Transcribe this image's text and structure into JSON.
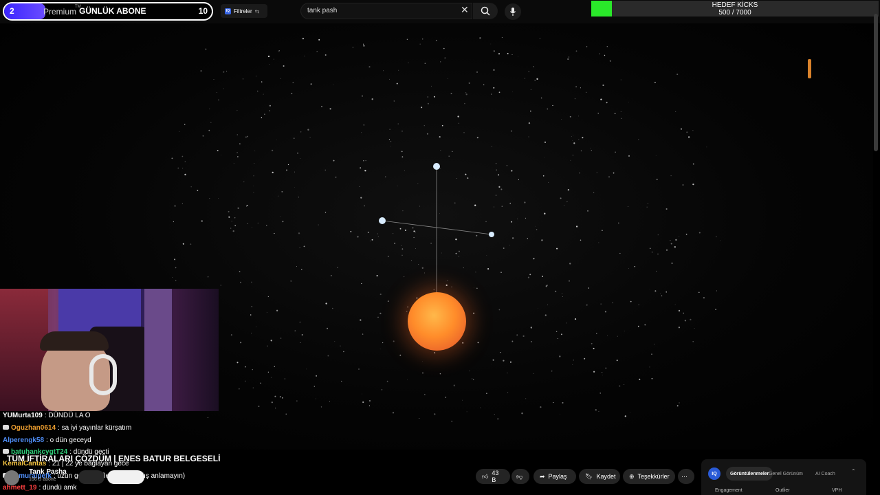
{
  "sub_widget": {
    "count": "2",
    "label": "Premium",
    "tm": "TM",
    "title": "GÜNLÜK ABONE",
    "goal": "10",
    "progress": 0.2
  },
  "search": {
    "filter_label": "Filtreler",
    "badge": "IQ",
    "query": "tank pash",
    "clear_icon": "close-icon",
    "search_icon": "search-icon",
    "mic_icon": "mic-icon"
  },
  "kicks": {
    "title": "HEDEF KİCKS",
    "count": "500 / 7000",
    "progress": 0.071
  },
  "chat": [
    {
      "user": "YUMurta109",
      "user_color": "#ffffff",
      "message": ": DÜNDÜ LA O",
      "icon": false
    },
    {
      "user": "Oguzhan0614",
      "user_color": "#f0a030",
      "message": ": sa iyi yayınlar kürşatım",
      "icon": true
    },
    {
      "user": "Alperengk58",
      "user_color": "#4f8ef7",
      "message": ": o dün geceyd",
      "icon": false
    },
    {
      "user": "batuhankcygtT24",
      "user_color": "#2fd07a",
      "message": ": dündü geçti",
      "icon": true
    },
    {
      "user": "KemalCantas",
      "user_color": "#f0c040",
      "message": ": 21 | 22 ye bağlayan gece",
      "icon": false
    },
    {
      "user": "samuraipefk",
      "user_color": "#4f8ef7",
      "message": ": uzun geceler bile ardın (yanlış anlamayın)",
      "icon": true
    },
    {
      "user": "ahmett_19",
      "user_color": "#ff4040",
      "message": ": dündü amk",
      "icon": false
    }
  ],
  "video": {
    "title": "TÜM İFTİRALARI ÇÖZDÜM | ENES BATUR BELGESELİ",
    "channel": "Tank Pasha",
    "subs": "166 B abone",
    "like_count": "43 B",
    "share": "Paylaş",
    "save": "Kaydet",
    "thanks": "Teşekkürler",
    "more": "⋯"
  },
  "analytics": {
    "logo": "IQ",
    "tabs": [
      "Görüntülenmeler",
      "Genel Görünüm",
      "AI Coach"
    ],
    "columns": [
      "Engagement",
      "Outlier",
      "VPH"
    ]
  }
}
